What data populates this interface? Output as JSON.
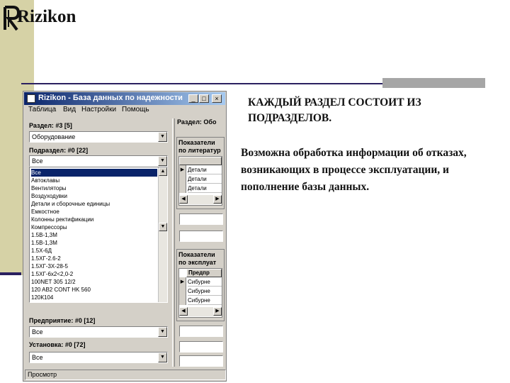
{
  "logo": {
    "text": "Rizikon"
  },
  "window": {
    "title": "Rizikon - База данных по надежности \\\\...",
    "menu": [
      "Таблица",
      "Вид",
      "Настройки",
      "Помощь"
    ],
    "section": {
      "label": "Раздел: #3 [5]",
      "value": "Оборудование"
    },
    "subsection": {
      "label": "Подраздел: #0 [22]",
      "value": "Все"
    },
    "list_items": [
      "Все",
      "Автоклавы",
      "Вентиляторы",
      "Воздуходувки",
      "Детали и сборочные единицы",
      "Емкостное",
      "Колонны ректификации",
      "Компрессоры",
      "1.5В-1,3М",
      "1.5В-1,3М",
      "1.5Х-6Д",
      "1.5ХГ-2.6-2",
      "1.5ХГ-3Х-28-5",
      "1.5ХГ-6х2<2,0-2",
      "100NET 305 12/2",
      "120 AB2 CONT HK 560",
      "120К104"
    ],
    "enterprise": {
      "label": "Предприятие: #0 [12]",
      "value": "Все"
    },
    "installation": {
      "label": "Установка: #0 [72]",
      "value": "Все"
    },
    "right_panel": {
      "section_label": "Раздел: Обо",
      "lit_title": [
        "Показатели",
        "по литератур"
      ],
      "lit_rows": [
        "Детали",
        "Детали",
        "Детали"
      ],
      "exp_title": [
        "Показатели",
        "по эксплуат"
      ],
      "exp_header": "Предпр",
      "exp_rows": [
        "Сибурне",
        "Сибурне",
        "Сибурне"
      ]
    },
    "status": "Просмотр"
  },
  "slide": {
    "heading": "КАЖДЫЙ РАЗДЕЛ СОСТОИТ ИЗ ПОДРАЗДЕЛОВ.",
    "body": "Возможна обработка информации об отказах, возникающих в процессе эксплуатации, и пополнение базы данных."
  },
  "colors": {
    "accent_olive": "#d6d2a6",
    "accent_navy": "#2b2060",
    "title_bar": "#0a246a"
  }
}
